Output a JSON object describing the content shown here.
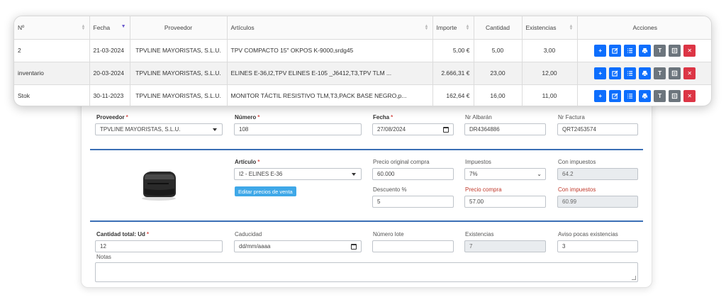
{
  "table": {
    "headers": {
      "num": "Nº",
      "fecha": "Fecha",
      "proveedor": "Proveedor",
      "articulos": "Artículos",
      "importe": "Importe",
      "cantidad": "Cantidad",
      "existencias": "Existencias",
      "acciones": "Acciones"
    },
    "rows": [
      {
        "num": "2",
        "fecha": "21-03-2024",
        "proveedor": "TPVLINE MAYORISTAS, S.L.U.",
        "articulos": "TPV COMPACTO 15\" OKPOS K-9000,srdg45",
        "importe": "5,00 €",
        "cantidad": "5,00",
        "existencias": "3,00"
      },
      {
        "num": "inventario",
        "fecha": "20-03-2024",
        "proveedor": "TPVLINE MAYORISTAS, S.L.U.",
        "articulos": "ELINES E-36,I2,TPV ELINES E-105 _J6412,T3,TPV TLM ...",
        "importe": "2.666,31 €",
        "cantidad": "23,00",
        "existencias": "12,00"
      },
      {
        "num": "Stok",
        "fecha": "30-11-2023",
        "proveedor": "TPVLINE MAYORISTAS, S.L.U.",
        "articulos": "MONITOR TÁCTIL RESISTIVO TLM,T3,PACK BASE NEGRO,p...",
        "importe": "162,64 €",
        "cantidad": "16,00",
        "existencias": "11,00"
      }
    ],
    "action_icons": [
      "plus-icon",
      "edit-icon",
      "list-icon",
      "print-icon",
      "t-icon",
      "document-icon",
      "delete-icon"
    ]
  },
  "form": {
    "proveedor_label": "Proveedor",
    "proveedor_value": "TPVLINE MAYORISTAS, S.L.U.",
    "numero_label": "Número",
    "numero_value": "108",
    "fecha_label": "Fecha",
    "fecha_value": "27/08/2024",
    "albaran_label": "Nr Albarán",
    "albaran_value": "DR4364886",
    "factura_label": "Nr Factura",
    "factura_value": "QRT2453574",
    "articulo_label": "Artículo",
    "articulo_value": "I2 - ELINES E-36",
    "edit_prices_label": "Editar precios de venta",
    "precio_original_label": "Precio original compra",
    "precio_original_value": "60.000",
    "impuestos_label": "Impuestos",
    "impuestos_value": "7%",
    "con_impuestos_label": "Con impuestos",
    "con_impuestos_value": "64.2",
    "descuento_label": "Descuento %",
    "descuento_value": "5",
    "precio_compra_label": "Precio compra",
    "precio_compra_value": "57.00",
    "con_impuestos2_label": "Con impuestos",
    "con_impuestos2_value": "60.99",
    "cantidad_label": "Cantidad total: Ud",
    "cantidad_value": "12",
    "caducidad_label": "Caducidad",
    "caducidad_placeholder": "dd/mm/aaaa",
    "lote_label": "Número lote",
    "lote_value": "",
    "existencias_label": "Existencias",
    "existencias_value": "7",
    "aviso_label": "Aviso pocas existencias",
    "aviso_value": "3",
    "notas_label": "Notas"
  },
  "colors": {
    "primary": "#0d6efd",
    "secondary": "#6c757d",
    "danger": "#dc3545",
    "accent_line": "#3a6fb5",
    "edit_button": "#3fa8e8"
  }
}
